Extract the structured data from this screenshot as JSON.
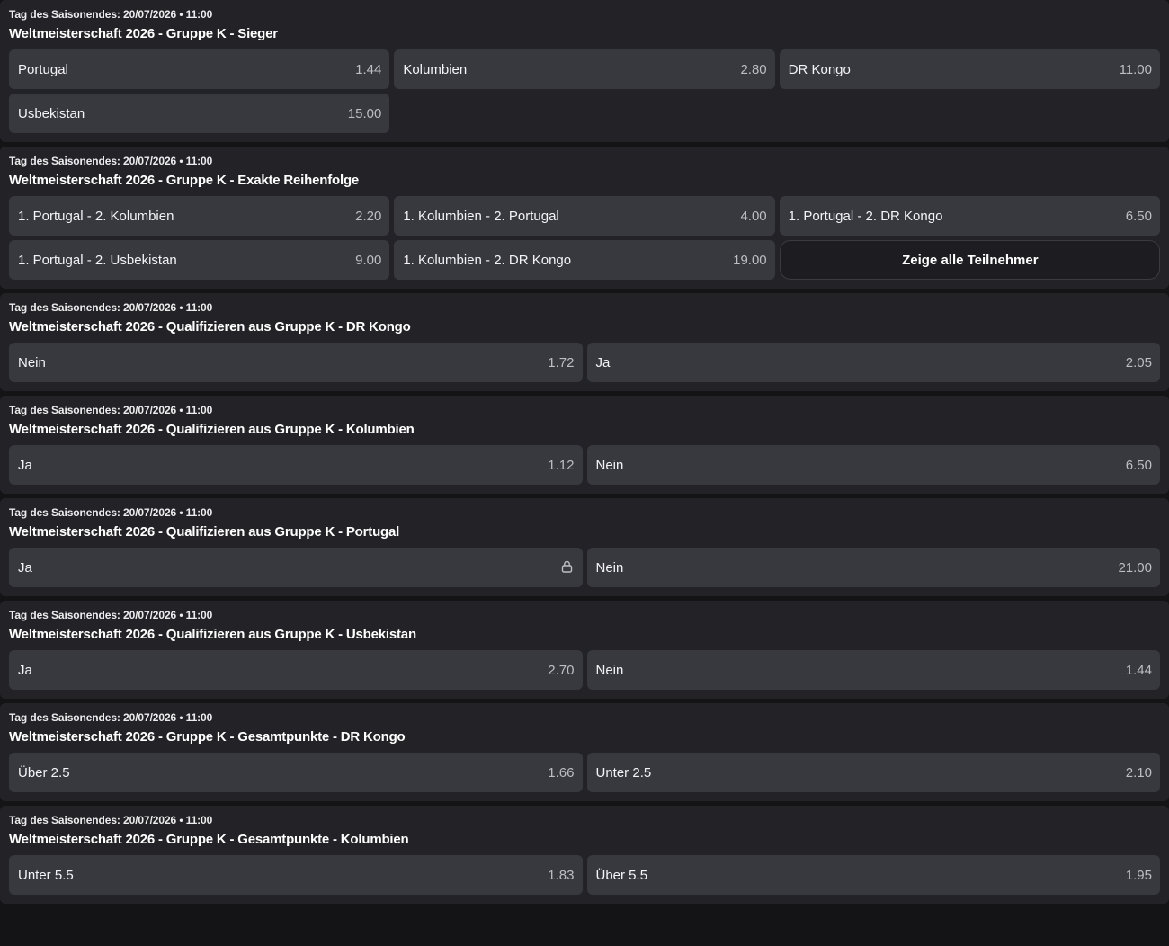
{
  "colors": {
    "page_bg": "#141416",
    "card_bg": "#232327",
    "outcome_bg": "#38383f",
    "odds_text": "#bdbdc3"
  },
  "markets": [
    {
      "meta": "Tag des Saisonendes: 20/07/2026 • 11:00",
      "title": "Weltmeisterschaft 2026 - Gruppe K - Sieger",
      "columns": 3,
      "outcomes": [
        {
          "label": "Portugal",
          "odds": "1.44"
        },
        {
          "label": "Kolumbien",
          "odds": "2.80"
        },
        {
          "label": "DR Kongo",
          "odds": "11.00"
        },
        {
          "label": "Usbekistan",
          "odds": "15.00"
        }
      ]
    },
    {
      "meta": "Tag des Saisonendes: 20/07/2026 • 11:00",
      "title": "Weltmeisterschaft 2026 - Gruppe K - Exakte Reihenfolge",
      "columns": 3,
      "outcomes": [
        {
          "label": "1. Portugal - 2. Kolumbien",
          "odds": "2.20"
        },
        {
          "label": "1. Kolumbien - 2. Portugal",
          "odds": "4.00"
        },
        {
          "label": "1. Portugal - 2. DR Kongo",
          "odds": "6.50"
        },
        {
          "label": "1. Portugal - 2. Usbekistan",
          "odds": "9.00"
        },
        {
          "label": "1. Kolumbien - 2. DR Kongo",
          "odds": "19.00"
        }
      ],
      "show_all_label": "Zeige alle Teilnehmer"
    },
    {
      "meta": "Tag des Saisonendes: 20/07/2026 • 11:00",
      "title": "Weltmeisterschaft 2026 - Qualifizieren aus Gruppe K - DR Kongo",
      "columns": 2,
      "outcomes": [
        {
          "label": "Nein",
          "odds": "1.72"
        },
        {
          "label": "Ja",
          "odds": "2.05"
        }
      ]
    },
    {
      "meta": "Tag des Saisonendes: 20/07/2026 • 11:00",
      "title": "Weltmeisterschaft 2026 - Qualifizieren aus Gruppe K - Kolumbien",
      "columns": 2,
      "outcomes": [
        {
          "label": "Ja",
          "odds": "1.12"
        },
        {
          "label": "Nein",
          "odds": "6.50"
        }
      ]
    },
    {
      "meta": "Tag des Saisonendes: 20/07/2026 • 11:00",
      "title": "Weltmeisterschaft 2026 - Qualifizieren aus Gruppe K - Portugal",
      "columns": 2,
      "outcomes": [
        {
          "label": "Ja",
          "odds": "",
          "locked": true,
          "icon": "lock-icon"
        },
        {
          "label": "Nein",
          "odds": "21.00"
        }
      ]
    },
    {
      "meta": "Tag des Saisonendes: 20/07/2026 • 11:00",
      "title": "Weltmeisterschaft 2026 - Qualifizieren aus Gruppe K - Usbekistan",
      "columns": 2,
      "outcomes": [
        {
          "label": "Ja",
          "odds": "2.70"
        },
        {
          "label": "Nein",
          "odds": "1.44"
        }
      ]
    },
    {
      "meta": "Tag des Saisonendes: 20/07/2026 • 11:00",
      "title": "Weltmeisterschaft 2026 - Gruppe K - Gesamtpunkte - DR Kongo",
      "columns": 2,
      "outcomes": [
        {
          "label": "Über 2.5",
          "odds": "1.66"
        },
        {
          "label": "Unter 2.5",
          "odds": "2.10"
        }
      ]
    },
    {
      "meta": "Tag des Saisonendes: 20/07/2026 • 11:00",
      "title": "Weltmeisterschaft 2026 - Gruppe K - Gesamtpunkte - Kolumbien",
      "columns": 2,
      "outcomes": [
        {
          "label": "Unter 5.5",
          "odds": "1.83"
        },
        {
          "label": "Über 5.5",
          "odds": "1.95"
        }
      ]
    }
  ]
}
